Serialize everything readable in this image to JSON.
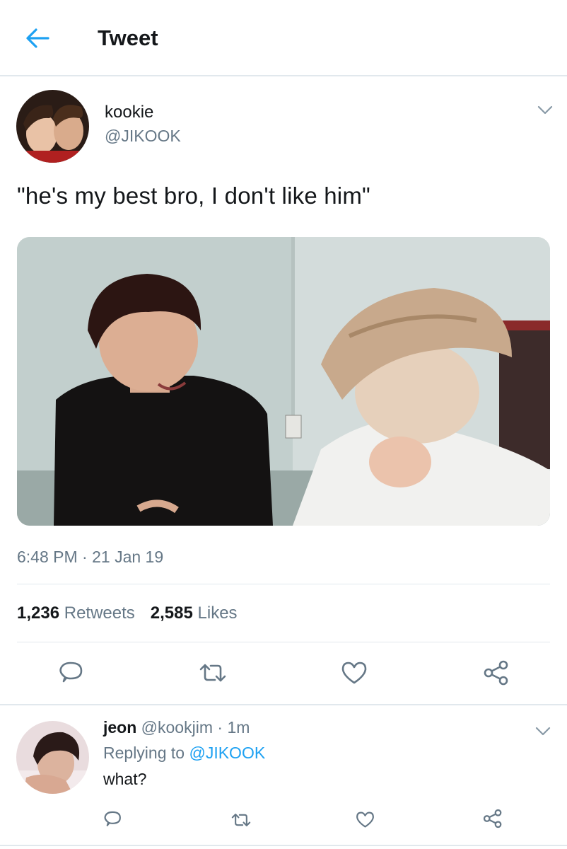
{
  "header": {
    "title": "Tweet"
  },
  "tweet": {
    "name": "kookie",
    "handle": "@JIKOOK",
    "text": "\"he's my best bro, I don't like him\"",
    "time": "6:48 PM",
    "date": "21 Jan 19",
    "retweets_count": "1,236",
    "retweets_label": "Retweets",
    "likes_count": "2,585",
    "likes_label": "Likes"
  },
  "reply": {
    "name": "jeon",
    "handle": "@kookjim",
    "age": "1m",
    "replying_label": "Replying to",
    "replying_to": "@JIKOOK",
    "text": "what?"
  },
  "icons": {
    "back": "back-arrow-icon",
    "more": "chevron-down-icon",
    "reply": "reply-icon",
    "retweet": "retweet-icon",
    "like": "heart-icon",
    "share": "share-icon"
  },
  "colors": {
    "accent": "#1da1f2",
    "icon_gray": "#657786",
    "divider": "#e1e8ed",
    "text": "#14171a"
  }
}
